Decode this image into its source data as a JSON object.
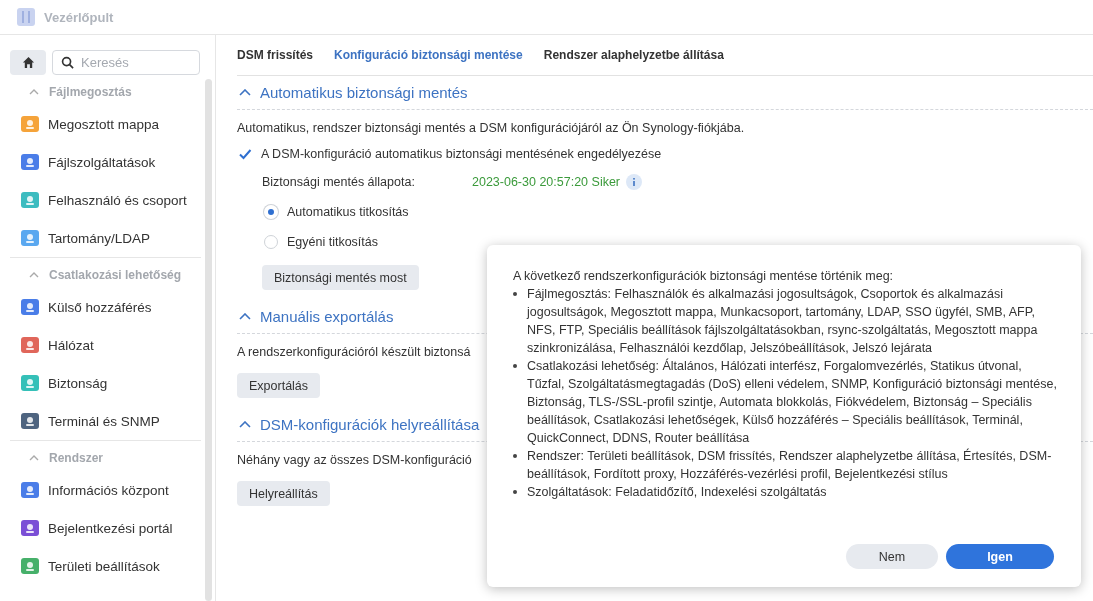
{
  "window": {
    "title": "Vezérlőpult"
  },
  "sidebar": {
    "search": {
      "placeholder": "Keresés"
    },
    "groups": [
      {
        "label": "Fájlmegosztás",
        "expanded": true,
        "items": [
          {
            "label": "Megosztott mappa",
            "selected": false
          },
          {
            "label": "Fájlszolgáltatások",
            "selected": false
          },
          {
            "label": "Felhasználó és csoport",
            "selected": false
          },
          {
            "label": "Tartomány/LDAP",
            "selected": false
          }
        ]
      },
      {
        "label": "Csatlakozási lehetőség",
        "expanded": true,
        "items": [
          {
            "label": "Külső hozzáférés",
            "selected": false
          },
          {
            "label": "Hálózat",
            "selected": false
          },
          {
            "label": "Biztonság",
            "selected": false
          },
          {
            "label": "Terminál és SNMP",
            "selected": false
          }
        ]
      },
      {
        "label": "Rendszer",
        "expanded": true,
        "items": [
          {
            "label": "Információs központ",
            "selected": false
          },
          {
            "label": "Bejelentkezési portál",
            "selected": false
          },
          {
            "label": "Területi beállítások",
            "selected": false
          }
        ]
      }
    ]
  },
  "tabs": [
    {
      "label": "DSM frissítés",
      "selected": false
    },
    {
      "label": "Konfiguráció biztonsági mentése",
      "selected": true
    },
    {
      "label": "Rendszer alaphelyzetbe állítása",
      "selected": false
    }
  ],
  "sections": [
    {
      "title": "Automatikus biztonsági mentés",
      "expanded": true,
      "description": "Automatikus, rendszer biztonsági mentés a DSM konfigurációjáról az Ön Synology-fiókjába.",
      "checkbox": {
        "label": "A DSM-konfiguráció automatikus biztonsági mentésének engedélyezése",
        "checked": true
      },
      "status": {
        "label": "Biztonsági mentés állapota:",
        "value": "2023-06-30 20:57:20 Siker"
      },
      "radios": [
        {
          "label": "Automatikus titkosítás",
          "selected": true
        },
        {
          "label": "Egyéni titkosítás",
          "selected": false
        }
      ],
      "button": "Biztonsági mentés most"
    },
    {
      "title": "Manuális exportálás",
      "expanded": true,
      "description": "A rendszerkonfigurációról készült biztonsá",
      "button": "Exportálás"
    },
    {
      "title": "DSM-konfigurációk helyreállítása",
      "expanded": true,
      "description": "Néhány vagy az összes DSM-konfiguráció",
      "button": "Helyreállítás"
    }
  ],
  "dialog": {
    "intro": "A következő rendszerkonfigurációk biztonsági mentése történik meg:",
    "bullets": [
      "Fájlmegosztás: Felhasználók és alkalmazási jogosultságok, Csoportok és alkalmazási jogosultságok, Megosztott mappa, Munkacsoport, tartomány, LDAP, SSO ügyfél, SMB, AFP, NFS, FTP, Speciális beállítások fájlszolgáltatásokban, rsync-szolgáltatás, Megosztott mappa szinkronizálása, Felhasználói kezdőlap, Jelszóbeállítások, Jelszó lejárata",
      "Csatlakozási lehetőség: Általános, Hálózati interfész, Forgalomvezérlés, Statikus útvonal, Tűzfal, Szolgáltatásmegtagadás (DoS) elleni védelem, SNMP, Konfiguráció biztonsági mentése, Biztonság, TLS-/SSL-profil szintje, Automata blokkolás, Fiókvédelem, Biztonság – Speciális beállítások, Csatlakozási lehetőségek, Külső hozzáférés – Speciális beállítások, Terminál, QuickConnect, DDNS, Router beállítása",
      "Rendszer: Területi beállítások, DSM frissítés, Rendszer alaphelyzetbe állítása, Értesítés, DSM-beállítások, Fordított proxy, Hozzáférés-vezérlési profil, Bejelentkezési stílus",
      "Szolgáltatások: Feladatidőzítő, Indexelési szolgáltatás"
    ],
    "buttons": [
      {
        "label": "Nem",
        "primary": false
      },
      {
        "label": "Igen",
        "primary": true
      }
    ]
  }
}
